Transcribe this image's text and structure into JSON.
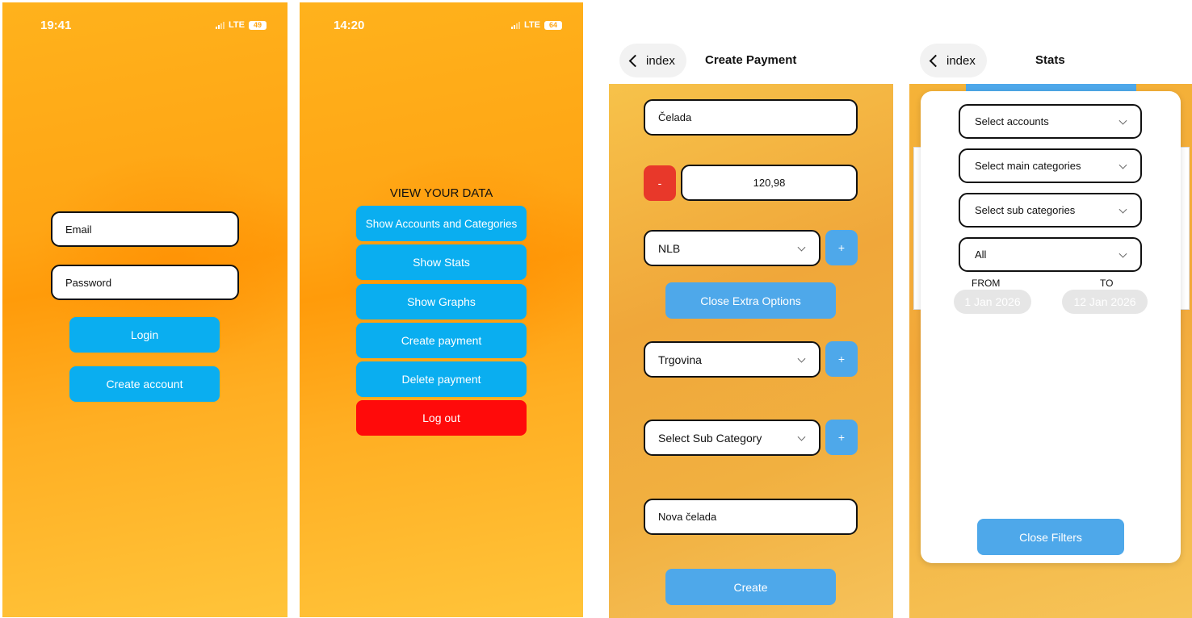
{
  "screen1": {
    "status": {
      "time": "19:41",
      "network": "LTE",
      "battery": "49"
    },
    "email_placeholder": "Email",
    "password_placeholder": "Password",
    "login_label": "Login",
    "create_account_label": "Create account"
  },
  "screen2": {
    "status": {
      "time": "14:20",
      "network": "LTE",
      "battery": "64"
    },
    "heading": "VIEW YOUR DATA",
    "buttons": [
      {
        "label": "Show Accounts and Categories"
      },
      {
        "label": "Show Stats"
      },
      {
        "label": "Show Graphs"
      },
      {
        "label": "Create payment"
      },
      {
        "label": "Delete payment"
      },
      {
        "label": "Log out"
      }
    ],
    "colors": {
      "primary": "#0aaef0",
      "danger": "#ff0a0a"
    }
  },
  "screen3": {
    "back_label": "index",
    "title": "Create Payment",
    "name_value": "Čelada",
    "sign_label": "-",
    "amount_value": "120,98",
    "account_select": "NLB",
    "add_label": "+",
    "close_extra_label": "Close Extra Options",
    "category_select": "Trgovina",
    "subcategory_select": "Select Sub Category",
    "description_value": "Nova čelada",
    "create_label": "Create"
  },
  "screen4": {
    "back_label": "index",
    "title": "Stats",
    "accounts_select": "Select accounts",
    "main_categories_select": "Select main categories",
    "sub_categories_select": "Select sub categories",
    "type_select": "All",
    "from_label": "FROM",
    "to_label": "TO",
    "from_date": "1 Jan 2026",
    "to_date": "12 Jan 2026",
    "close_filters_label": "Close Filters"
  }
}
